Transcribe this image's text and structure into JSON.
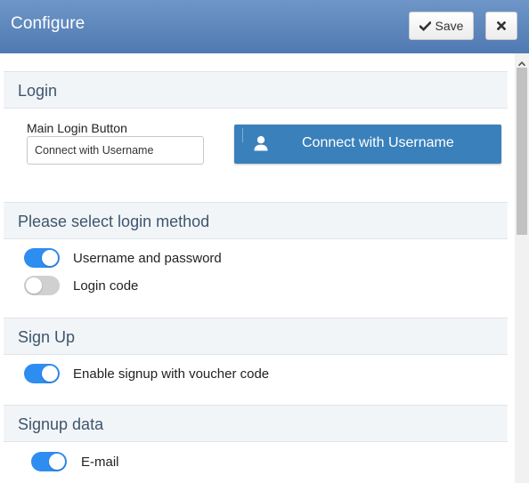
{
  "header": {
    "title": "Configure",
    "save_label": "Save",
    "save_icon": "check-icon",
    "close_icon": "close-icon"
  },
  "sections": {
    "login": {
      "title": "Login",
      "main_button_label": "Main Login Button",
      "main_button_value": "Connect with Username",
      "preview_label": "Connect with Username",
      "preview_icon": "user-icon",
      "preview_color": "#3a80ba"
    },
    "method": {
      "title": "Please select login method",
      "options": [
        {
          "label": "Username and password",
          "enabled": true
        },
        {
          "label": "Login code",
          "enabled": false
        }
      ]
    },
    "signup": {
      "title": "Sign Up",
      "options": [
        {
          "label": "Enable signup with voucher code",
          "enabled": true
        }
      ]
    },
    "signup_data": {
      "title": "Signup data",
      "options": [
        {
          "label": "E-mail",
          "enabled": true
        }
      ]
    }
  },
  "colors": {
    "header": "#5a84bb",
    "toggle_on": "#2e8df0",
    "toggle_off": "#d0d0d0",
    "section_bg": "#f2f5f8"
  }
}
